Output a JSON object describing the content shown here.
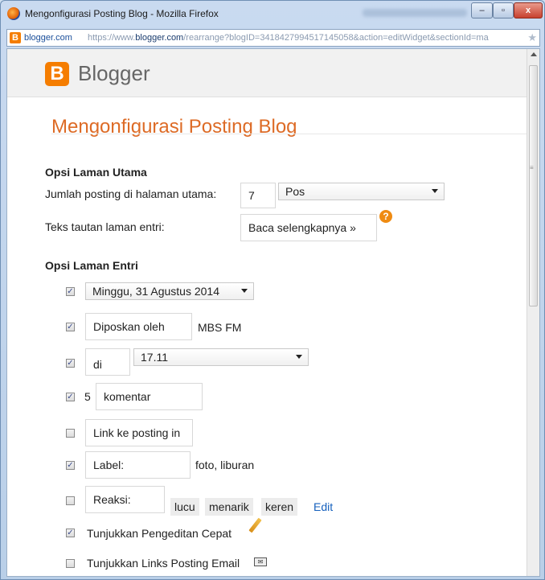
{
  "window": {
    "title": "Mengonfigurasi Posting Blog - Mozilla Firefox",
    "controls": {
      "minimize": "–",
      "maximize": "▫",
      "close": "x"
    }
  },
  "url": {
    "domain": "blogger.com",
    "prefix": "https://www.",
    "host": "blogger.com",
    "rest": "/rearrange?blogID=3418427994517145058&action=editWidget&sectionId=ma"
  },
  "header": {
    "logo_letter": "B",
    "logo_text": "Blogger"
  },
  "page": {
    "title": "Mengonfigurasi Posting Blog"
  },
  "main_options": {
    "heading": "Opsi Laman Utama",
    "posts_label": "Jumlah posting di halaman utama:",
    "posts_value": "7",
    "posts_unit": "Pos",
    "read_more_label": "Teks tautan laman entri:",
    "read_more_value": "Baca selengkapnya »",
    "help": "?"
  },
  "entry_options": {
    "heading": "Opsi Laman Entri",
    "date": {
      "checked": true,
      "value": "Minggu, 31 Agustus 2014"
    },
    "posted_by": {
      "checked": true,
      "input": "Diposkan oleh",
      "author": "MBS FM"
    },
    "time": {
      "checked": true,
      "input": "di",
      "value": "17.11"
    },
    "comments": {
      "checked": true,
      "count": "5",
      "input": "komentar"
    },
    "link": {
      "checked": false,
      "input": "Link ke posting in"
    },
    "labels": {
      "checked": true,
      "input": "Label:",
      "values": "foto, liburan"
    },
    "reactions": {
      "checked": false,
      "input": "Reaksi:",
      "chips": [
        "lucu",
        "menarik",
        "keren"
      ],
      "edit": "Edit"
    },
    "quick_edit": {
      "checked": true,
      "label": "Tunjukkan Pengeditan Cepat"
    },
    "email_links": {
      "checked": false,
      "label": "Tunjukkan Links Posting Email"
    }
  },
  "colors": {
    "accent": "#dd6b26",
    "brand": "#f57d00",
    "link": "#1560bd"
  }
}
